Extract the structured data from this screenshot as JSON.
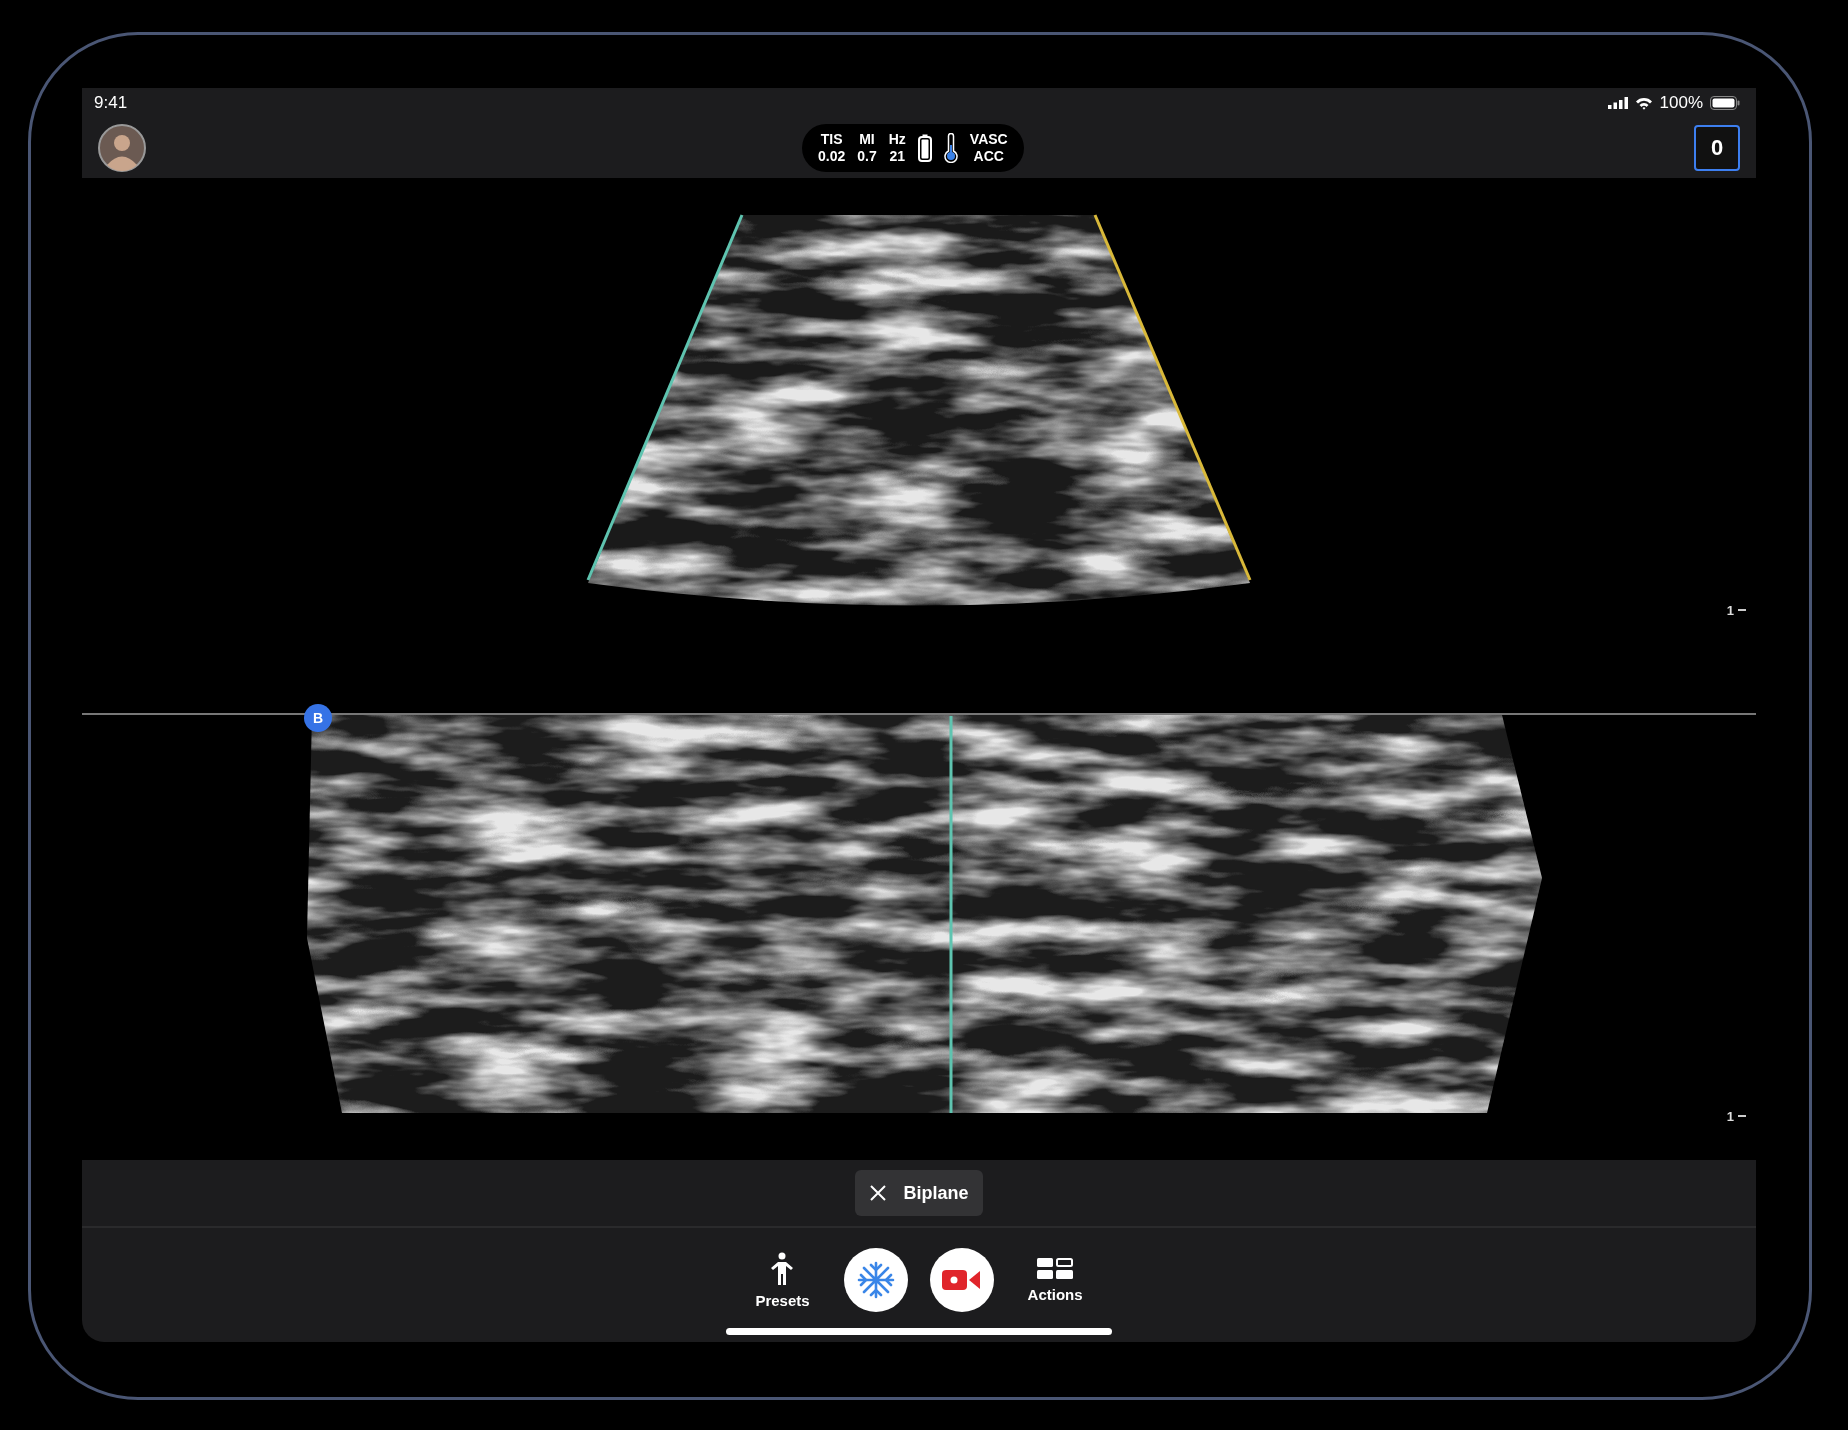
{
  "status_bar": {
    "time": "9:41",
    "battery": "100%"
  },
  "toolbar": {
    "readouts": [
      {
        "label": "TIS",
        "value": "0.02"
      },
      {
        "label": "MI",
        "value": "0.7"
      },
      {
        "label": "Hz",
        "value": "21"
      }
    ],
    "preset": {
      "label": "VASC",
      "value": "ACC"
    },
    "clip_count": "0"
  },
  "imaging": {
    "depth_marks": [
      "1",
      "1"
    ],
    "plane_marker": "B"
  },
  "mode_chip": {
    "label": "Biplane"
  },
  "controls": [
    {
      "kind": "presets",
      "label": "Presets"
    },
    {
      "kind": "freeze"
    },
    {
      "kind": "record"
    },
    {
      "kind": "actions",
      "label": "Actions"
    }
  ]
}
